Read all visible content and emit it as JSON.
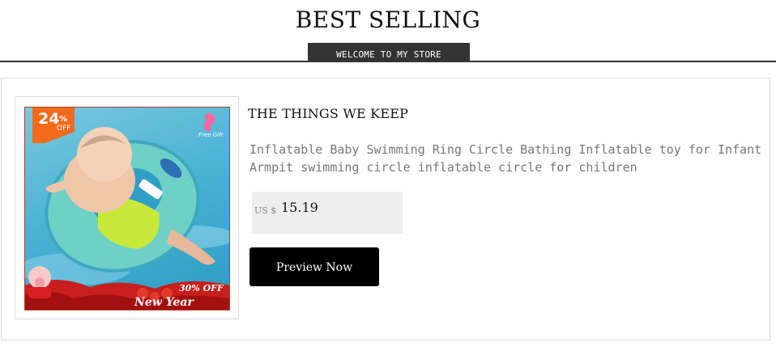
{
  "header": {
    "title": "BEST SELLING",
    "tagline": "WELCOME TO MY STORE"
  },
  "product": {
    "discount_number": "24",
    "discount_percent": "%",
    "discount_off": "OFF",
    "image_badge_free_gift": "Free Gift",
    "image_banner_off": "30% OFF",
    "image_banner_sale": "New Year Sales",
    "brand": "THE THINGS WE KEEP",
    "description": "Inflatable Baby Swimming Ring Circle Bathing Inflatable toy for Infant Armpit swimming circle inflatable circle for children",
    "currency": "US $",
    "price": "15.19",
    "cta_label": "Preview Now"
  },
  "colors": {
    "discount_badge": "#f26a1b",
    "button_bg": "#000000",
    "price_box_bg": "#eeeeee",
    "tagline_bg": "#333333"
  }
}
